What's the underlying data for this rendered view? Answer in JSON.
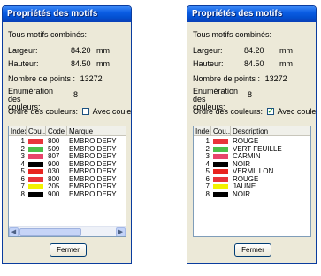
{
  "left_window": {
    "title": "Propriétés des motifs",
    "subtitle": "Tous motifs combinés:",
    "width_label": "Largeur:",
    "width_value": "84.20",
    "width_unit": "mm",
    "height_label": "Hauteur:",
    "height_value": "84.50",
    "height_unit": "mm",
    "points_label": "Nombre de points :",
    "points_value": "13272",
    "enum_label": "Enumération des couleurs:",
    "enum_value": "8",
    "order_label": "Ordre des couleurs:",
    "checkbox_label": "Avec couleur de base",
    "checkbox_checked": false,
    "columns": [
      "Index",
      "Cou...",
      "Code",
      "Marque"
    ],
    "rows": [
      {
        "index": "1",
        "color": "#e8353b",
        "code": "800",
        "brand": "EMBROIDERY"
      },
      {
        "index": "2",
        "color": "#4bc04b",
        "code": "509",
        "brand": "EMBROIDERY"
      },
      {
        "index": "3",
        "color": "#e8446b",
        "code": "807",
        "brand": "EMBROIDERY"
      },
      {
        "index": "4",
        "color": "#000000",
        "code": "900",
        "brand": "EMBROIDERY"
      },
      {
        "index": "5",
        "color": "#e8231f",
        "code": "030",
        "brand": "EMBROIDERY"
      },
      {
        "index": "6",
        "color": "#e8353b",
        "code": "800",
        "brand": "EMBROIDERY"
      },
      {
        "index": "7",
        "color": "#f2f200",
        "code": "205",
        "brand": "EMBROIDERY"
      },
      {
        "index": "8",
        "color": "#000000",
        "code": "900",
        "brand": "EMBROIDERY"
      }
    ],
    "close_button": "Fermer"
  },
  "right_window": {
    "title": "Propriétés des motifs",
    "subtitle": "Tous motifs combinés:",
    "width_label": "Largeur:",
    "width_value": "84.20",
    "width_unit": "mm",
    "height_label": "Hauteur:",
    "height_value": "84.50",
    "height_unit": "mm",
    "points_label": "Nombre de points :",
    "points_value": "13272",
    "enum_label": "Enumération des couleurs:",
    "enum_value": "8",
    "order_label": "Ordre des couleurs:",
    "checkbox_label": "Avec couleur de base",
    "checkbox_checked": true,
    "columns": [
      "Index",
      "Cou...",
      "Description"
    ],
    "rows": [
      {
        "index": "1",
        "color": "#e8353b",
        "description": "ROUGE"
      },
      {
        "index": "2",
        "color": "#4bc04b",
        "description": "VERT FEUILLE"
      },
      {
        "index": "3",
        "color": "#e8446b",
        "description": "CARMIN"
      },
      {
        "index": "4",
        "color": "#000000",
        "description": "NOIR"
      },
      {
        "index": "5",
        "color": "#e8231f",
        "description": "VERMILLON"
      },
      {
        "index": "6",
        "color": "#e8353b",
        "description": "ROUGE"
      },
      {
        "index": "7",
        "color": "#f2f200",
        "description": "JAUNE"
      },
      {
        "index": "8",
        "color": "#000000",
        "description": "NOIR"
      }
    ],
    "close_button": "Fermer"
  }
}
